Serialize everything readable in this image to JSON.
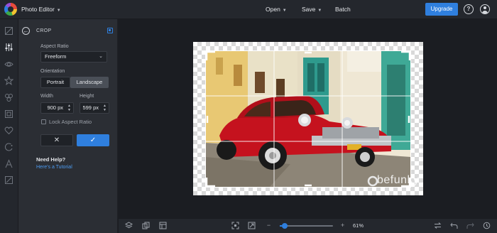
{
  "app": {
    "title": "Photo Editor",
    "accent_color": "#2f7fde"
  },
  "header": {
    "open_label": "Open",
    "save_label": "Save",
    "batch_label": "Batch",
    "upgrade_label": "Upgrade",
    "help_icon": "help-icon",
    "user_icon": "user-icon"
  },
  "toolrail": {
    "tools": [
      "image-icon",
      "adjust-sliders-icon",
      "eye-icon",
      "star-icon",
      "shapes-icon",
      "frame-icon",
      "heart-icon",
      "texture-icon",
      "text-icon",
      "slash-icon"
    ]
  },
  "crop_panel": {
    "title": "CROP",
    "aspect_ratio_label": "Aspect Ratio",
    "aspect_ratio_value": "Freeform",
    "orientation_label": "Orientation",
    "portrait_label": "Portrait",
    "landscape_label": "Landscape",
    "selected_orientation": "Landscape",
    "width_label": "Width",
    "height_label": "Height",
    "width_value": "900 px",
    "height_value": "599 px",
    "lock_label": "Lock Aspect Ratio",
    "lock_checked": false,
    "cancel_symbol": "✕",
    "apply_symbol": "✓",
    "help_title": "Need Help?",
    "tutorial_link": "Here's a Tutorial"
  },
  "canvas": {
    "watermark": "befunky"
  },
  "bottombar": {
    "zoom_out": "−",
    "zoom_in": "+",
    "zoom_value": "61%",
    "zoom_fraction": 0.61
  }
}
